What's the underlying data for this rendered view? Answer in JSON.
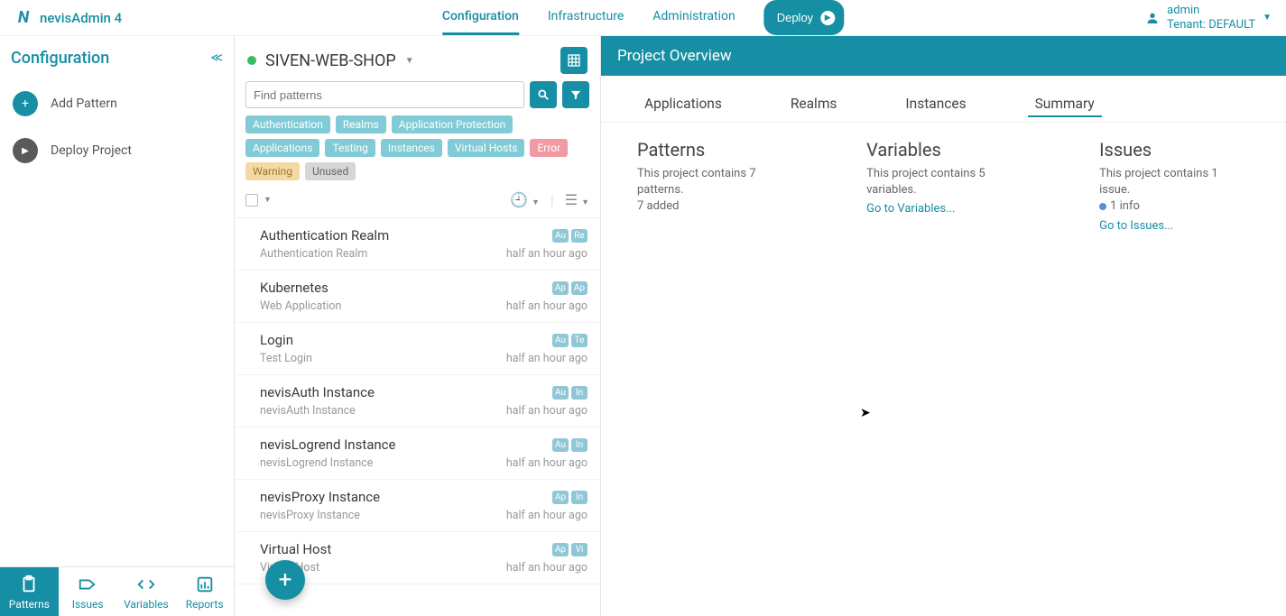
{
  "header": {
    "app_name": "nevisAdmin 4",
    "nav": {
      "config": "Configuration",
      "infra": "Infrastructure",
      "admin": "Administration"
    },
    "deploy": "Deploy",
    "user": {
      "name": "admin",
      "tenant": "Tenant: DEFAULT"
    }
  },
  "sidebar": {
    "title": "Configuration",
    "add": "Add Pattern",
    "deploy": "Deploy Project",
    "footer": {
      "patterns": "Patterns",
      "issues": "Issues",
      "variables": "Variables",
      "reports": "Reports"
    }
  },
  "mid": {
    "project": "SIVEN-WEB-SHOP",
    "search_placeholder": "Find patterns",
    "tags": {
      "auth": "Authentication",
      "realms": "Realms",
      "approt": "Application Protection",
      "apps": "Applications",
      "testing": "Testing",
      "instances": "Instances",
      "vhosts": "Virtual Hosts",
      "error": "Error",
      "warning": "Warning",
      "unused": "Unused"
    },
    "patterns": [
      {
        "title": "Authentication Realm",
        "sub": "Authentication Realm",
        "time": "half an hour ago",
        "b1": "Au",
        "b2": "Re"
      },
      {
        "title": "Kubernetes",
        "sub": "Web Application",
        "time": "half an hour ago",
        "b1": "Ap",
        "b2": "Ap"
      },
      {
        "title": "Login",
        "sub": "Test Login",
        "time": "half an hour ago",
        "b1": "Au",
        "b2": "Te"
      },
      {
        "title": "nevisAuth Instance",
        "sub": "nevisAuth Instance",
        "time": "half an hour ago",
        "b1": "Au",
        "b2": "In"
      },
      {
        "title": "nevisLogrend Instance",
        "sub": "nevisLogrend Instance",
        "time": "half an hour ago",
        "b1": "Au",
        "b2": "In"
      },
      {
        "title": "nevisProxy Instance",
        "sub": "nevisProxy Instance",
        "time": "half an hour ago",
        "b1": "Ap",
        "b2": "In"
      },
      {
        "title": "Virtual Host",
        "sub": "Virtual Host",
        "time": "half an hour ago",
        "b1": "Ap",
        "b2": "Vi"
      }
    ]
  },
  "right": {
    "title": "Project Overview",
    "tabs": {
      "apps": "Applications",
      "realms": "Realms",
      "instances": "Instances",
      "summary": "Summary"
    },
    "patterns": {
      "h": "Patterns",
      "p1": "This project contains 7 patterns.",
      "p2": "7 added"
    },
    "variables": {
      "h": "Variables",
      "p1": "This project contains 5 variables.",
      "link": "Go to Variables..."
    },
    "issues": {
      "h": "Issues",
      "p1": "This project contains 1 issue.",
      "info": "1 info",
      "link": "Go to Issues..."
    }
  }
}
